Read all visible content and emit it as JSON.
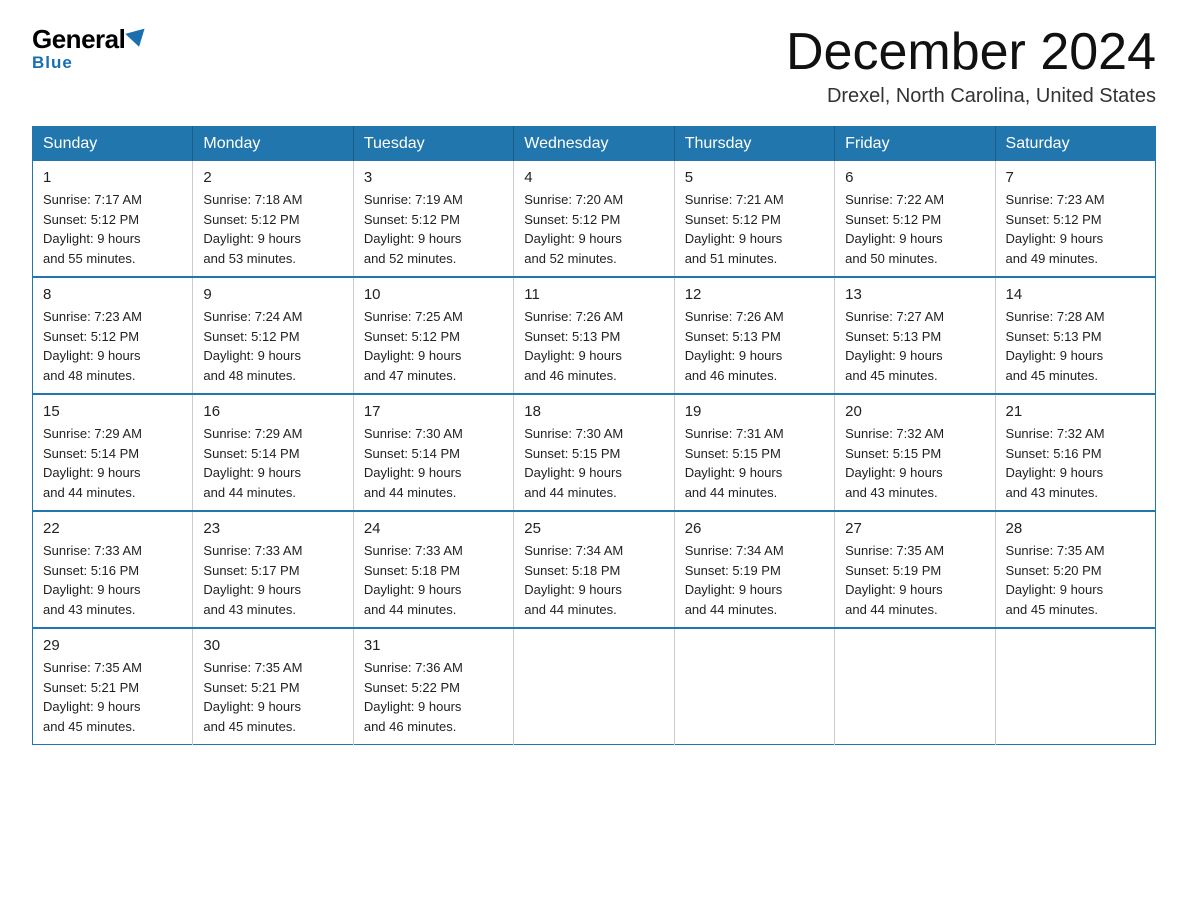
{
  "header": {
    "logo_general": "General",
    "logo_blue": "Blue",
    "month_title": "December 2024",
    "location": "Drexel, North Carolina, United States"
  },
  "weekdays": [
    "Sunday",
    "Monday",
    "Tuesday",
    "Wednesday",
    "Thursday",
    "Friday",
    "Saturday"
  ],
  "weeks": [
    [
      {
        "day": "1",
        "sunrise": "7:17 AM",
        "sunset": "5:12 PM",
        "daylight": "9 hours and 55 minutes."
      },
      {
        "day": "2",
        "sunrise": "7:18 AM",
        "sunset": "5:12 PM",
        "daylight": "9 hours and 53 minutes."
      },
      {
        "day": "3",
        "sunrise": "7:19 AM",
        "sunset": "5:12 PM",
        "daylight": "9 hours and 52 minutes."
      },
      {
        "day": "4",
        "sunrise": "7:20 AM",
        "sunset": "5:12 PM",
        "daylight": "9 hours and 52 minutes."
      },
      {
        "day": "5",
        "sunrise": "7:21 AM",
        "sunset": "5:12 PM",
        "daylight": "9 hours and 51 minutes."
      },
      {
        "day": "6",
        "sunrise": "7:22 AM",
        "sunset": "5:12 PM",
        "daylight": "9 hours and 50 minutes."
      },
      {
        "day": "7",
        "sunrise": "7:23 AM",
        "sunset": "5:12 PM",
        "daylight": "9 hours and 49 minutes."
      }
    ],
    [
      {
        "day": "8",
        "sunrise": "7:23 AM",
        "sunset": "5:12 PM",
        "daylight": "9 hours and 48 minutes."
      },
      {
        "day": "9",
        "sunrise": "7:24 AM",
        "sunset": "5:12 PM",
        "daylight": "9 hours and 48 minutes."
      },
      {
        "day": "10",
        "sunrise": "7:25 AM",
        "sunset": "5:12 PM",
        "daylight": "9 hours and 47 minutes."
      },
      {
        "day": "11",
        "sunrise": "7:26 AM",
        "sunset": "5:13 PM",
        "daylight": "9 hours and 46 minutes."
      },
      {
        "day": "12",
        "sunrise": "7:26 AM",
        "sunset": "5:13 PM",
        "daylight": "9 hours and 46 minutes."
      },
      {
        "day": "13",
        "sunrise": "7:27 AM",
        "sunset": "5:13 PM",
        "daylight": "9 hours and 45 minutes."
      },
      {
        "day": "14",
        "sunrise": "7:28 AM",
        "sunset": "5:13 PM",
        "daylight": "9 hours and 45 minutes."
      }
    ],
    [
      {
        "day": "15",
        "sunrise": "7:29 AM",
        "sunset": "5:14 PM",
        "daylight": "9 hours and 44 minutes."
      },
      {
        "day": "16",
        "sunrise": "7:29 AM",
        "sunset": "5:14 PM",
        "daylight": "9 hours and 44 minutes."
      },
      {
        "day": "17",
        "sunrise": "7:30 AM",
        "sunset": "5:14 PM",
        "daylight": "9 hours and 44 minutes."
      },
      {
        "day": "18",
        "sunrise": "7:30 AM",
        "sunset": "5:15 PM",
        "daylight": "9 hours and 44 minutes."
      },
      {
        "day": "19",
        "sunrise": "7:31 AM",
        "sunset": "5:15 PM",
        "daylight": "9 hours and 44 minutes."
      },
      {
        "day": "20",
        "sunrise": "7:32 AM",
        "sunset": "5:15 PM",
        "daylight": "9 hours and 43 minutes."
      },
      {
        "day": "21",
        "sunrise": "7:32 AM",
        "sunset": "5:16 PM",
        "daylight": "9 hours and 43 minutes."
      }
    ],
    [
      {
        "day": "22",
        "sunrise": "7:33 AM",
        "sunset": "5:16 PM",
        "daylight": "9 hours and 43 minutes."
      },
      {
        "day": "23",
        "sunrise": "7:33 AM",
        "sunset": "5:17 PM",
        "daylight": "9 hours and 43 minutes."
      },
      {
        "day": "24",
        "sunrise": "7:33 AM",
        "sunset": "5:18 PM",
        "daylight": "9 hours and 44 minutes."
      },
      {
        "day": "25",
        "sunrise": "7:34 AM",
        "sunset": "5:18 PM",
        "daylight": "9 hours and 44 minutes."
      },
      {
        "day": "26",
        "sunrise": "7:34 AM",
        "sunset": "5:19 PM",
        "daylight": "9 hours and 44 minutes."
      },
      {
        "day": "27",
        "sunrise": "7:35 AM",
        "sunset": "5:19 PM",
        "daylight": "9 hours and 44 minutes."
      },
      {
        "day": "28",
        "sunrise": "7:35 AM",
        "sunset": "5:20 PM",
        "daylight": "9 hours and 45 minutes."
      }
    ],
    [
      {
        "day": "29",
        "sunrise": "7:35 AM",
        "sunset": "5:21 PM",
        "daylight": "9 hours and 45 minutes."
      },
      {
        "day": "30",
        "sunrise": "7:35 AM",
        "sunset": "5:21 PM",
        "daylight": "9 hours and 45 minutes."
      },
      {
        "day": "31",
        "sunrise": "7:36 AM",
        "sunset": "5:22 PM",
        "daylight": "9 hours and 46 minutes."
      },
      null,
      null,
      null,
      null
    ]
  ],
  "labels": {
    "sunrise": "Sunrise:",
    "sunset": "Sunset:",
    "daylight": "Daylight:"
  }
}
